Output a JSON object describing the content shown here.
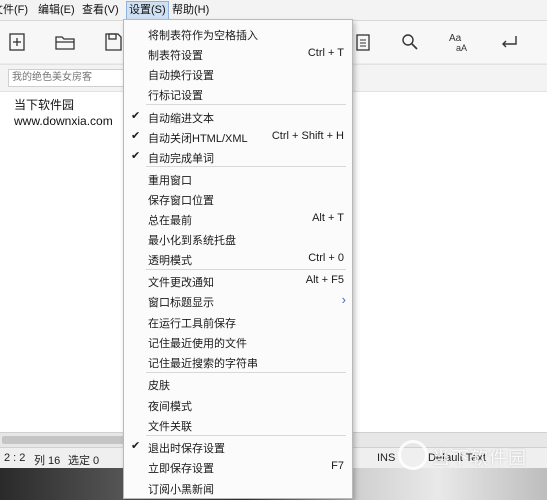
{
  "menubar": {
    "items": [
      "文件(F)",
      "编辑(E)",
      "查看(V)",
      "设置(S)",
      "帮助(H)"
    ]
  },
  "toolbar": {
    "icons": [
      "new-file-icon",
      "open-folder-icon",
      "save-icon",
      "clipboard-icon",
      "search-icon",
      "font-size-icon",
      "return-icon"
    ]
  },
  "search": {
    "placeholder": "我的绝色美女房客"
  },
  "editor": {
    "lines": [
      "当下软件园",
      "www.downxia.com"
    ]
  },
  "settings_menu": {
    "items": [
      {
        "label": "将制表符作为空格插入",
        "shortcut": "",
        "checked": false
      },
      {
        "label": "制表符设置",
        "shortcut": "Ctrl + T",
        "checked": false
      },
      {
        "label": "自动换行设置",
        "shortcut": "",
        "checked": false
      },
      {
        "label": "行标记设置",
        "shortcut": "",
        "checked": false
      },
      {
        "label": "自动缩进文本",
        "shortcut": "",
        "checked": true
      },
      {
        "label": "自动关闭HTML/XML",
        "shortcut": "Ctrl + Shift + H",
        "checked": true
      },
      {
        "label": "自动完成单词",
        "shortcut": "",
        "checked": true
      },
      {
        "label": "重用窗口",
        "shortcut": "",
        "checked": false
      },
      {
        "label": "保存窗口位置",
        "shortcut": "",
        "checked": false
      },
      {
        "label": "总在最前",
        "shortcut": "Alt + T",
        "checked": false
      },
      {
        "label": "最小化到系统托盘",
        "shortcut": "",
        "checked": false
      },
      {
        "label": "透明模式",
        "shortcut": "Ctrl + 0",
        "checked": false
      },
      {
        "label": "文件更改通知",
        "shortcut": "Alt + F5",
        "checked": false
      },
      {
        "label": "窗口标题显示",
        "shortcut": "",
        "checked": false,
        "submenu": true
      },
      {
        "label": "在运行工具前保存",
        "shortcut": "",
        "checked": false
      },
      {
        "label": "记住最近使用的文件",
        "shortcut": "",
        "checked": false
      },
      {
        "label": "记住最近搜索的字符串",
        "shortcut": "",
        "checked": false
      },
      {
        "label": "皮肤",
        "shortcut": "",
        "checked": false
      },
      {
        "label": "夜间模式",
        "shortcut": "",
        "checked": false
      },
      {
        "label": "文件关联",
        "shortcut": "",
        "checked": false
      },
      {
        "label": "退出时保存设置",
        "shortcut": "",
        "checked": true
      },
      {
        "label": "立即保存设置",
        "shortcut": "F7",
        "checked": false
      },
      {
        "label": "订阅小黑新闻",
        "shortcut": "",
        "checked": false
      }
    ]
  },
  "statusbar": {
    "position": "2 : 2",
    "column": "列 16",
    "selected": "选定 0",
    "mode": "INS",
    "syntax": "Default Text"
  },
  "watermark": {
    "text": "当下软件园"
  }
}
